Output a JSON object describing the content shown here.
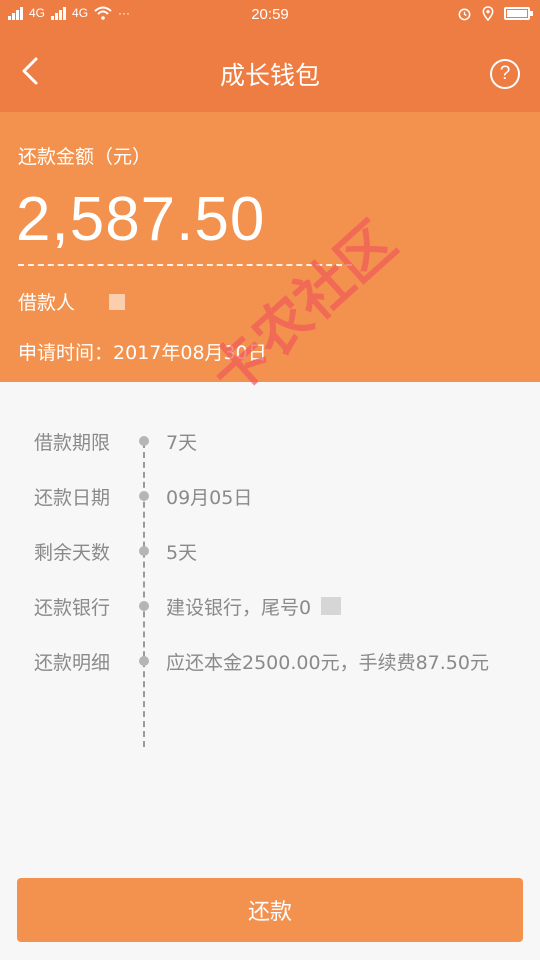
{
  "status_bar": {
    "carrier_1": "4G",
    "carrier_2": "4G",
    "more": "···",
    "time": "20:59",
    "icons": [
      "signal-icon",
      "wifi-icon",
      "alarm-icon",
      "location-icon",
      "battery-icon"
    ]
  },
  "nav": {
    "title": "成长钱包",
    "back_icon": "chevron-left-icon",
    "help_label": "?"
  },
  "summary": {
    "amount_label": "还款金额（元）",
    "amount_value": "2,587.50",
    "borrower_label": "借款人",
    "apply_label": "申请时间：",
    "apply_date": "2017年08月30日"
  },
  "details": [
    {
      "label": "借款期限",
      "value": "7天"
    },
    {
      "label": "还款日期",
      "value": "09月05日"
    },
    {
      "label": "剩余天数",
      "value": "5天"
    },
    {
      "label": "还款银行",
      "value": "建设银行，尾号0"
    },
    {
      "label": "还款明细",
      "value": "应还本金2500.00元，手续费87.50元"
    }
  ],
  "watermark": "卡农社区",
  "repay_button": "还款",
  "colors": {
    "header": "#ee7d43",
    "summary_bg": "#f3924e",
    "page_bg": "#f7f7f7"
  }
}
